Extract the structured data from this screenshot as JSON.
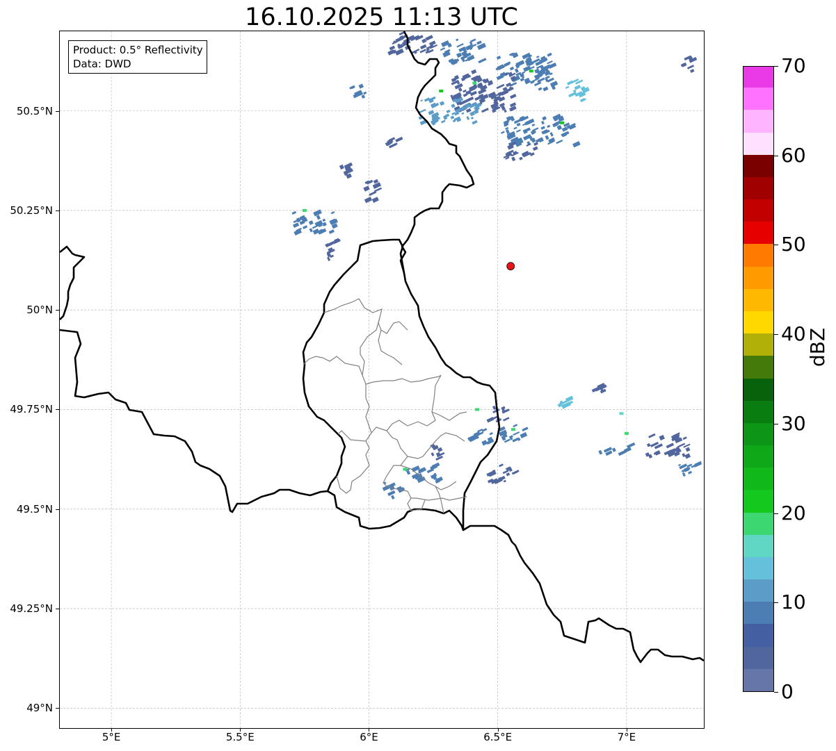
{
  "title": "16.10.2025 11:13 UTC",
  "info_box": {
    "line1": "Product: 0.5° Reflectivity",
    "line2": "Data: DWD"
  },
  "map": {
    "extent": {
      "lon_min": 4.8,
      "lon_max": 7.3,
      "lat_min": 48.95,
      "lat_max": 50.7
    },
    "lat_ticks": [
      {
        "value": 50.5,
        "label": "50.5°N"
      },
      {
        "value": 50.25,
        "label": "50.25°N"
      },
      {
        "value": 50.0,
        "label": "50°N"
      },
      {
        "value": 49.75,
        "label": "49.75°N"
      },
      {
        "value": 49.5,
        "label": "49.5°N"
      },
      {
        "value": 49.25,
        "label": "49.25°N"
      },
      {
        "value": 49.0,
        "label": "49°N"
      }
    ],
    "lon_ticks": [
      {
        "value": 5.0,
        "label": "5°E"
      },
      {
        "value": 5.5,
        "label": "5.5°E"
      },
      {
        "value": 6.0,
        "label": "6°E"
      },
      {
        "value": 6.5,
        "label": "6.5°E"
      },
      {
        "value": 7.0,
        "label": "7°E"
      }
    ],
    "gridlines": true,
    "radar_site": {
      "lon": 6.55,
      "lat": 50.11,
      "color": "#e8141b"
    },
    "border_color": "#000000",
    "admin_border_color": "#808080"
  },
  "colorbar": {
    "label": "dBZ",
    "min": 0,
    "max": 70,
    "step": 2.5,
    "tick_labels": [
      "0",
      "10",
      "20",
      "30",
      "40",
      "50",
      "60",
      "70"
    ],
    "colors": [
      "#6676a8",
      "#52669e",
      "#4460a2",
      "#4c7db3",
      "#5b9dc8",
      "#65c0dc",
      "#60d7c5",
      "#3cd770",
      "#14c81e",
      "#10b81a",
      "#0fa818",
      "#0d9615",
      "#0a7d10",
      "#07620b",
      "#447a0a",
      "#b0b008",
      "#ffd800",
      "#ffb800",
      "#ff9a00",
      "#ff7b00",
      "#e60000",
      "#c20000",
      "#a00000",
      "#7a0000",
      "#ffe0ff",
      "#ffb4ff",
      "#ff72ff",
      "#ea3ae8"
    ]
  },
  "precip_cells": [
    {
      "lon": 6.15,
      "lat": 50.67,
      "w": 0.18,
      "h": 0.05,
      "color": "#52669e"
    },
    {
      "lon": 6.35,
      "lat": 50.65,
      "w": 0.15,
      "h": 0.06,
      "color": "#4c7db3"
    },
    {
      "lon": 6.6,
      "lat": 50.6,
      "w": 0.22,
      "h": 0.09,
      "color": "#4c7db3"
    },
    {
      "lon": 6.43,
      "lat": 50.55,
      "w": 0.24,
      "h": 0.1,
      "color": "#52669e"
    },
    {
      "lon": 6.3,
      "lat": 50.5,
      "w": 0.22,
      "h": 0.06,
      "color": "#5b9dc8"
    },
    {
      "lon": 6.65,
      "lat": 50.45,
      "w": 0.28,
      "h": 0.07,
      "color": "#4c7db3"
    },
    {
      "lon": 6.8,
      "lat": 50.55,
      "w": 0.08,
      "h": 0.05,
      "color": "#65c0dc"
    },
    {
      "lon": 6.58,
      "lat": 50.4,
      "w": 0.12,
      "h": 0.04,
      "color": "#52669e"
    },
    {
      "lon": 5.95,
      "lat": 50.55,
      "w": 0.08,
      "h": 0.03,
      "color": "#4c7db3"
    },
    {
      "lon": 6.08,
      "lat": 50.42,
      "w": 0.05,
      "h": 0.02,
      "color": "#52669e"
    },
    {
      "lon": 5.78,
      "lat": 50.22,
      "w": 0.16,
      "h": 0.05,
      "color": "#4c7db3"
    },
    {
      "lon": 5.9,
      "lat": 50.35,
      "w": 0.04,
      "h": 0.03,
      "color": "#52669e"
    },
    {
      "lon": 5.85,
      "lat": 50.15,
      "w": 0.05,
      "h": 0.06,
      "color": "#52669e"
    },
    {
      "lon": 6.0,
      "lat": 50.3,
      "w": 0.05,
      "h": 0.05,
      "color": "#52669e"
    },
    {
      "lon": 7.22,
      "lat": 50.62,
      "w": 0.06,
      "h": 0.04,
      "color": "#52669e"
    },
    {
      "lon": 6.48,
      "lat": 49.74,
      "w": 0.08,
      "h": 0.04,
      "color": "#52669e"
    },
    {
      "lon": 6.55,
      "lat": 49.69,
      "w": 0.1,
      "h": 0.04,
      "color": "#4c7db3"
    },
    {
      "lon": 6.42,
      "lat": 49.68,
      "w": 0.1,
      "h": 0.04,
      "color": "#4c7db3"
    },
    {
      "lon": 6.5,
      "lat": 49.59,
      "w": 0.12,
      "h": 0.04,
      "color": "#52669e"
    },
    {
      "lon": 6.2,
      "lat": 49.59,
      "w": 0.12,
      "h": 0.04,
      "color": "#4c7db3"
    },
    {
      "lon": 6.08,
      "lat": 49.55,
      "w": 0.07,
      "h": 0.04,
      "color": "#4c7db3"
    },
    {
      "lon": 6.26,
      "lat": 49.64,
      "w": 0.05,
      "h": 0.04,
      "color": "#52669e"
    },
    {
      "lon": 7.15,
      "lat": 49.66,
      "w": 0.16,
      "h": 0.05,
      "color": "#52669e"
    },
    {
      "lon": 6.95,
      "lat": 49.65,
      "w": 0.12,
      "h": 0.02,
      "color": "#4c7db3"
    },
    {
      "lon": 7.24,
      "lat": 49.6,
      "w": 0.1,
      "h": 0.03,
      "color": "#4c7db3"
    },
    {
      "lon": 6.75,
      "lat": 49.77,
      "w": 0.04,
      "h": 0.02,
      "color": "#65c0dc"
    },
    {
      "lon": 6.87,
      "lat": 49.8,
      "w": 0.06,
      "h": 0.02,
      "color": "#52669e"
    }
  ],
  "precip_highlights": [
    {
      "lon": 6.28,
      "lat": 50.55,
      "color": "#14c81e"
    },
    {
      "lon": 6.41,
      "lat": 50.57,
      "color": "#3cd770"
    },
    {
      "lon": 6.63,
      "lat": 50.6,
      "color": "#14c81e"
    },
    {
      "lon": 6.75,
      "lat": 50.47,
      "color": "#14c81e"
    },
    {
      "lon": 5.75,
      "lat": 50.25,
      "color": "#3cd770"
    },
    {
      "lon": 6.56,
      "lat": 49.7,
      "color": "#3cd770"
    },
    {
      "lon": 6.42,
      "lat": 49.75,
      "color": "#3cd770"
    },
    {
      "lon": 6.14,
      "lat": 49.6,
      "color": "#3cd770"
    },
    {
      "lon": 7.0,
      "lat": 49.69,
      "color": "#3cd770"
    },
    {
      "lon": 6.98,
      "lat": 49.74,
      "color": "#60d7c5"
    }
  ]
}
